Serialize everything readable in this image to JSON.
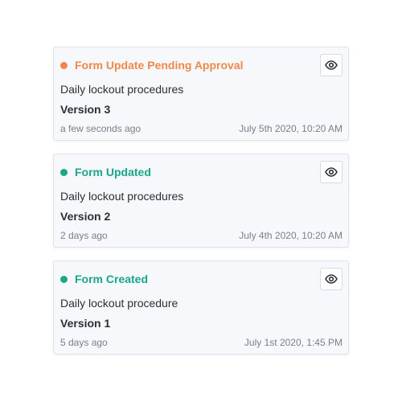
{
  "colors": {
    "pending": "#f0884a",
    "success": "#1aa68a"
  },
  "icons": {
    "view": "eye-icon"
  },
  "events": [
    {
      "status": "Form Update Pending Approval",
      "status_color": "#f0884a",
      "form_name": "Daily lockout procedures",
      "version": "Version 3",
      "relative_time": "a few seconds ago",
      "timestamp": "July 5th 2020, 10:20 AM"
    },
    {
      "status": "Form Updated",
      "status_color": "#1aa68a",
      "form_name": "Daily lockout procedures",
      "version": "Version 2",
      "relative_time": "2 days ago",
      "timestamp": "July 4th 2020, 10:20 AM"
    },
    {
      "status": "Form Created",
      "status_color": "#1aa68a",
      "form_name": "Daily lockout procedure",
      "version": "Version 1",
      "relative_time": "5 days ago",
      "timestamp": "July 1st 2020, 1:45 PM"
    }
  ]
}
